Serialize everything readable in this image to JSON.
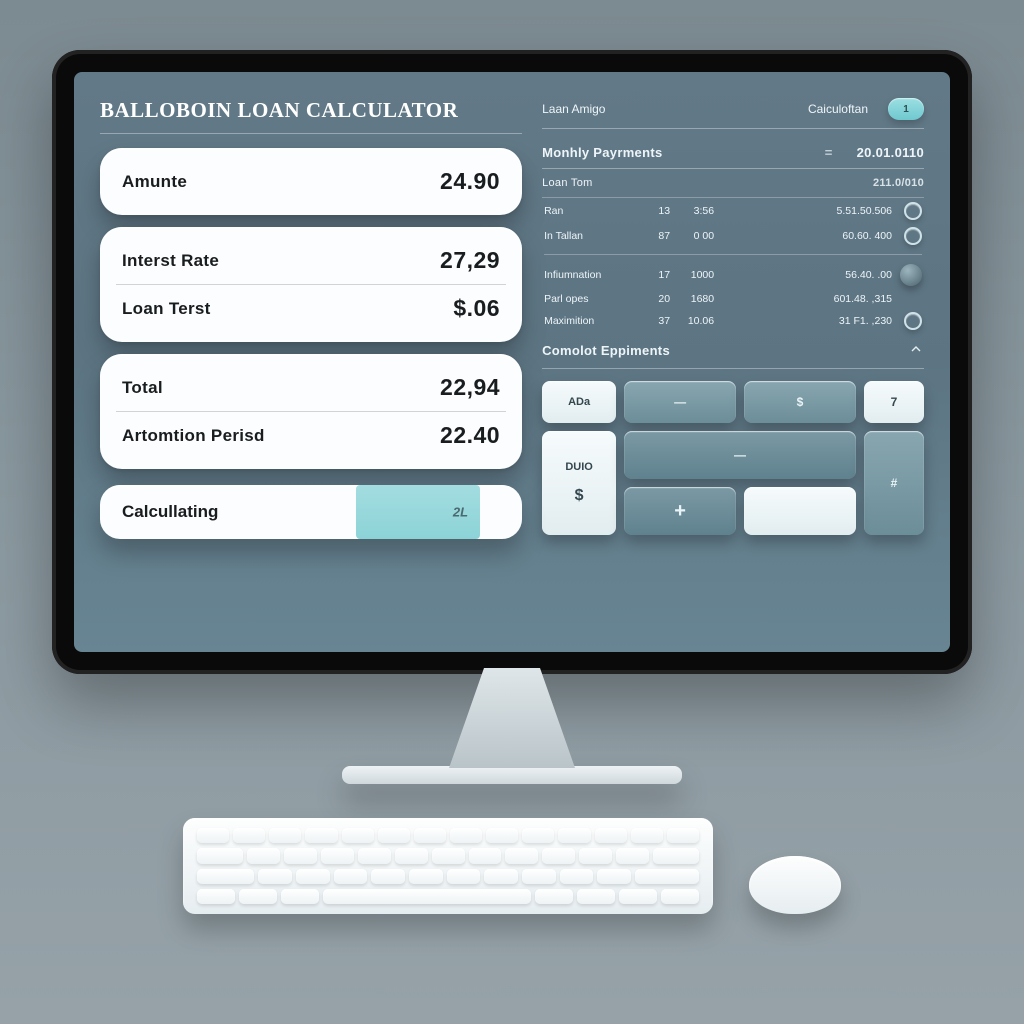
{
  "title": "BaLLOBOIN LOAN CaLCULATOR",
  "inputs": {
    "amount": {
      "label": "Amunte",
      "value": "24.90"
    },
    "rate": {
      "label": "Interst Rate",
      "value": "27,29"
    },
    "term": {
      "label": "Loan Terst",
      "value": "$.06"
    },
    "total": {
      "label": "Total",
      "value": "22,94"
    },
    "amort": {
      "label": "Artomtion Perisd",
      "value": "22.40"
    }
  },
  "progress": {
    "label": "Calcullating",
    "grip": "2L"
  },
  "right": {
    "headerLeft": "Laan Amigo",
    "headerRight": "Caiculoftan",
    "pill": "1",
    "monthly": {
      "title": "Monhly Payrments",
      "eq": "=",
      "aside": "20.01.0110",
      "loanTermLabel": "Loan Tom",
      "loanTermValue": "211.0/010"
    },
    "rows": [
      {
        "label": "Ran",
        "c1": "13",
        "c2": "3:56",
        "c3": "5.51.50.506",
        "mark": "circle"
      },
      {
        "label": "In Tallan",
        "c1": "87",
        "c2": "0 00",
        "c3": "60.60. 400",
        "mark": "circle"
      },
      {
        "label": "Infiumnation",
        "c1": "17",
        "c2": "1000",
        "c3": "56.40. .00",
        "mark": "balloon"
      },
      {
        "label": "Parl opes",
        "c1": "20",
        "c2": "1680",
        "c3": "601.48. ,315",
        "mark": ""
      },
      {
        "label": "Maximition",
        "c1": "37",
        "c2": "10.06",
        "c3": "31 F1. ,230",
        "mark": "circle"
      }
    ],
    "bottomTitle": "Comolot Eppiments",
    "keys": {
      "a1": "ADa",
      "a2": "—",
      "a3": "$",
      "a4": "7",
      "b1": "DUIO",
      "b3": "—",
      "b4": "#",
      "c1": "$",
      "c2": "+"
    }
  }
}
